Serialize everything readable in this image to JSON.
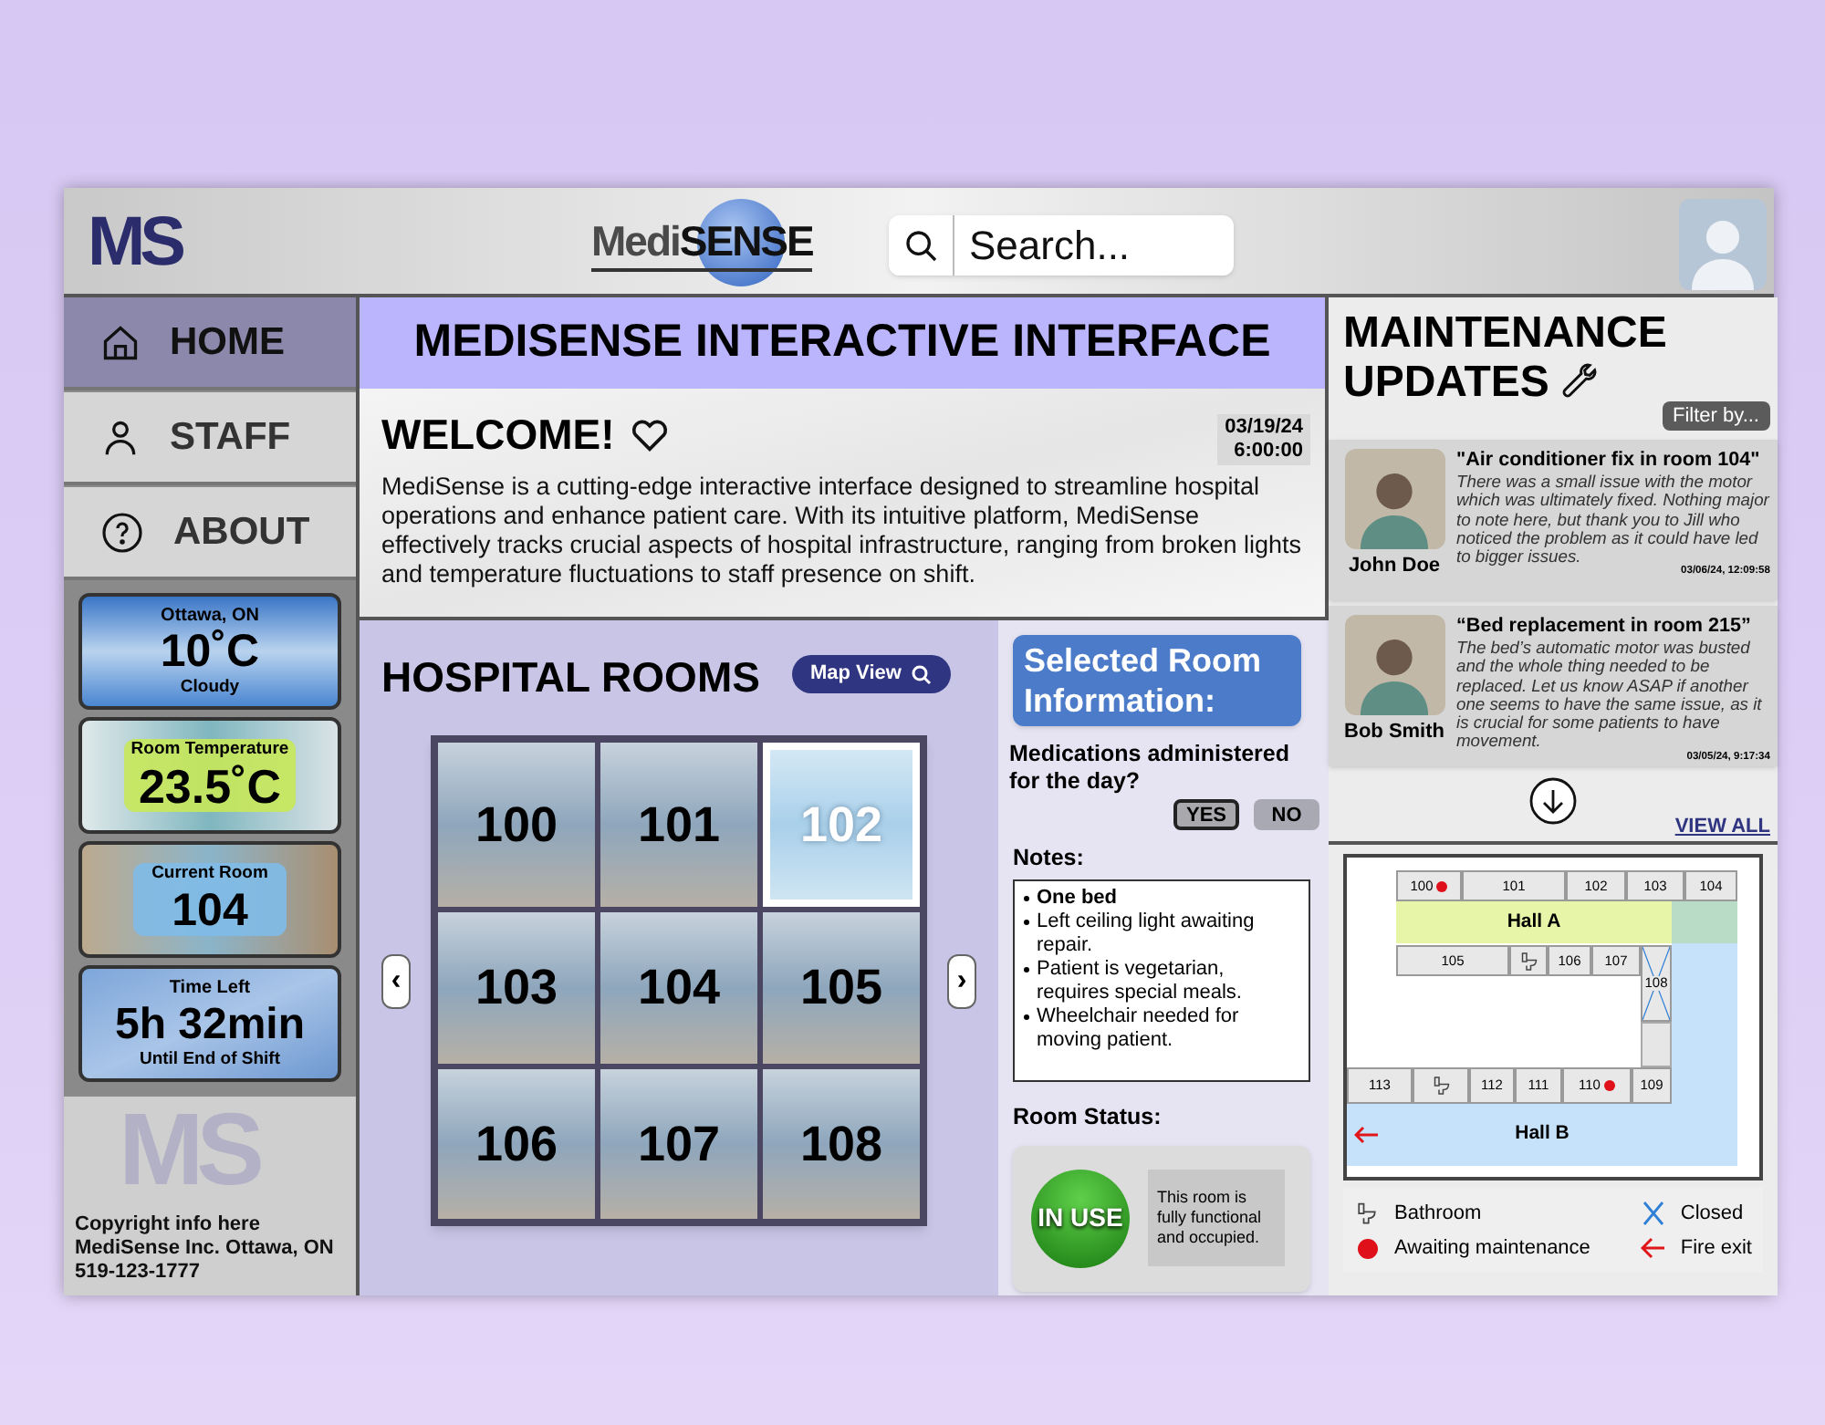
{
  "header": {
    "logo_mark": "MS",
    "brand": {
      "light": "Medi",
      "bold": "SENSE"
    },
    "search": {
      "placeholder": "Search..."
    }
  },
  "sidebar": {
    "nav": [
      {
        "label": "HOME",
        "selected": true
      },
      {
        "label": "STAFF",
        "selected": false
      },
      {
        "label": "ABOUT",
        "selected": false
      }
    ],
    "cards": [
      {
        "kind": "weather",
        "title": "Ottawa, ON",
        "value": "10˚C",
        "caption": "Cloudy"
      },
      {
        "kind": "temperature",
        "title": "Room Temperature",
        "value": "23.5˚C"
      },
      {
        "kind": "room",
        "title": "Current Room",
        "value": "104"
      },
      {
        "kind": "time",
        "title": "Time Left",
        "value": "5h 32min",
        "caption": "Until End of Shift"
      }
    ],
    "footer": {
      "watermark": "MS",
      "lines": [
        "Copyright info here",
        "MediSense Inc. Ottawa, ON",
        "519-123-1777"
      ]
    }
  },
  "main": {
    "title": "MEDISENSE INTERACTIVE INTERFACE",
    "welcome": {
      "heading": "WELCOME!",
      "date": "03/19/24",
      "time": "6:00:00",
      "text": "MediSense is a cutting-edge interactive interface designed to streamline hospital operations and enhance patient care. With its intuitive platform, MediSense effectively tracks crucial aspects of hospital infrastructure, ranging from broken lights and temperature fluctuations to staff presence on shift."
    },
    "rooms": {
      "heading": "HOSPITAL ROOMS",
      "map_button": "Map View",
      "prev": "‹",
      "next": "›",
      "items": [
        {
          "number": "100",
          "selected": false
        },
        {
          "number": "101",
          "selected": false
        },
        {
          "number": "102",
          "selected": true
        },
        {
          "number": "103",
          "selected": false
        },
        {
          "number": "104",
          "selected": false
        },
        {
          "number": "105",
          "selected": false
        },
        {
          "number": "106",
          "selected": false
        },
        {
          "number": "107",
          "selected": false
        },
        {
          "number": "108",
          "selected": false
        }
      ]
    },
    "room_info": {
      "heading": "Selected Room Information:",
      "question": "Medications administered for the day?",
      "options": [
        {
          "label": "YES",
          "selected": true
        },
        {
          "label": "NO",
          "selected": false
        }
      ],
      "notes_label": "Notes:",
      "notes": [
        {
          "text": "One bed",
          "bold": true
        },
        {
          "text": "Left ceiling light awaiting repair.",
          "bold": false
        },
        {
          "text": "Patient is vegetarian, requires special meals.",
          "bold": false
        },
        {
          "text": "Wheelchair needed for moving patient.",
          "bold": false
        }
      ],
      "status_label": "Room Status:",
      "status": {
        "badge": "IN USE",
        "description": "This room is fully functional and occupied."
      }
    }
  },
  "maintenance": {
    "heading": [
      "MAINTENANCE",
      "UPDATES"
    ],
    "filter": "Filter by...",
    "updates": [
      {
        "author": "John Doe",
        "title": "\"Air conditioner fix in room 104\"",
        "body": "There was a small issue with the motor which was ultimately fixed. Nothing major to note here, but thank you to Jill who noticed the problem as it could have led to bigger issues.",
        "timestamp": "03/06/24, 12:09:58"
      },
      {
        "author": "Bob Smith",
        "title": "“Bed replacement in room 215”",
        "body": "The bed’s automatic motor was busted and the whole thing needed to be replaced. Let us know ASAP if another one seems to have the same issue, as it is crucial for some patients to have movement.",
        "timestamp": "03/05/24, 9:17:34"
      }
    ],
    "view_all": "VIEW ALL"
  },
  "floor_map": {
    "rooms": [
      {
        "label": "100",
        "kind": "room",
        "awaiting_maintenance": true,
        "closed": false
      },
      {
        "label": "101",
        "kind": "room",
        "awaiting_maintenance": false,
        "closed": false
      },
      {
        "label": "102",
        "kind": "room",
        "awaiting_maintenance": false,
        "closed": false
      },
      {
        "label": "103",
        "kind": "room",
        "awaiting_maintenance": false,
        "closed": false
      },
      {
        "label": "104",
        "kind": "room",
        "awaiting_maintenance": false,
        "closed": false
      },
      {
        "label": "105",
        "kind": "room",
        "awaiting_maintenance": false,
        "closed": false
      },
      {
        "kind": "bathroom",
        "awaiting_maintenance": false,
        "closed": false
      },
      {
        "label": "106",
        "kind": "room",
        "awaiting_maintenance": false,
        "closed": false
      },
      {
        "label": "107",
        "kind": "room",
        "awaiting_maintenance": false,
        "closed": false
      },
      {
        "label": "108",
        "kind": "room",
        "awaiting_maintenance": false,
        "closed": true
      },
      {
        "label": "113",
        "kind": "room",
        "awaiting_maintenance": false,
        "closed": false
      },
      {
        "kind": "bathroom",
        "awaiting_maintenance": false,
        "closed": false
      },
      {
        "label": "112",
        "kind": "room",
        "awaiting_maintenance": false,
        "closed": false
      },
      {
        "label": "111",
        "kind": "room",
        "awaiting_maintenance": false,
        "closed": false
      },
      {
        "label": "110",
        "kind": "room",
        "awaiting_maintenance": true,
        "closed": false
      },
      {
        "label": "109",
        "kind": "room",
        "awaiting_maintenance": false,
        "closed": false
      }
    ],
    "halls": [
      {
        "label": "Hall A",
        "fire_exit": false
      },
      {
        "label": "Hall B",
        "fire_exit": true
      }
    ],
    "legend": [
      {
        "kind": "bathroom",
        "label": "Bathroom"
      },
      {
        "kind": "closed",
        "label": "Closed"
      },
      {
        "kind": "maintenance",
        "label": "Awaiting maintenance"
      },
      {
        "kind": "fire_exit",
        "label": "Fire exit"
      }
    ]
  }
}
